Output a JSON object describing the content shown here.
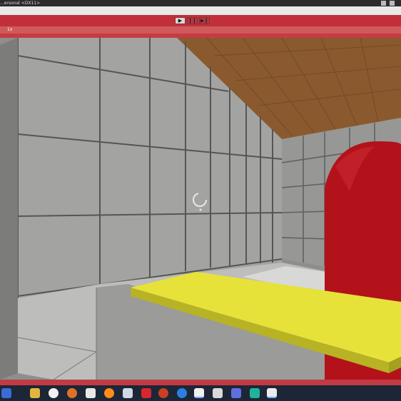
{
  "window": {
    "title": "...ersonal <DX11>"
  },
  "toolbar": {
    "play_glyph": "▶",
    "pause_glyph": "❙❙",
    "step_glyph": "▶❙"
  },
  "panel": {
    "label": "1x"
  },
  "viewport": {
    "loading_icon": "spinner-icon"
  },
  "taskbar": {
    "icons": [
      "start-icon",
      "file-explorer-icon",
      "chrome-icon",
      "app-icon",
      "terminal-icon",
      "firefox-icon",
      "steam-icon",
      "record-icon",
      "app-icon-2",
      "firefox-dev-icon",
      "unity-icon",
      "store-icon",
      "discord-icon",
      "terminal-2-icon",
      "unity-2-icon"
    ]
  },
  "colors": {
    "accent_red": "#c1303a",
    "wall_gray": "#8c8c8a",
    "ceiling_brown": "#8a5a2e",
    "platform_yellow": "#e6e23a",
    "capsule_red": "#b3121b"
  }
}
